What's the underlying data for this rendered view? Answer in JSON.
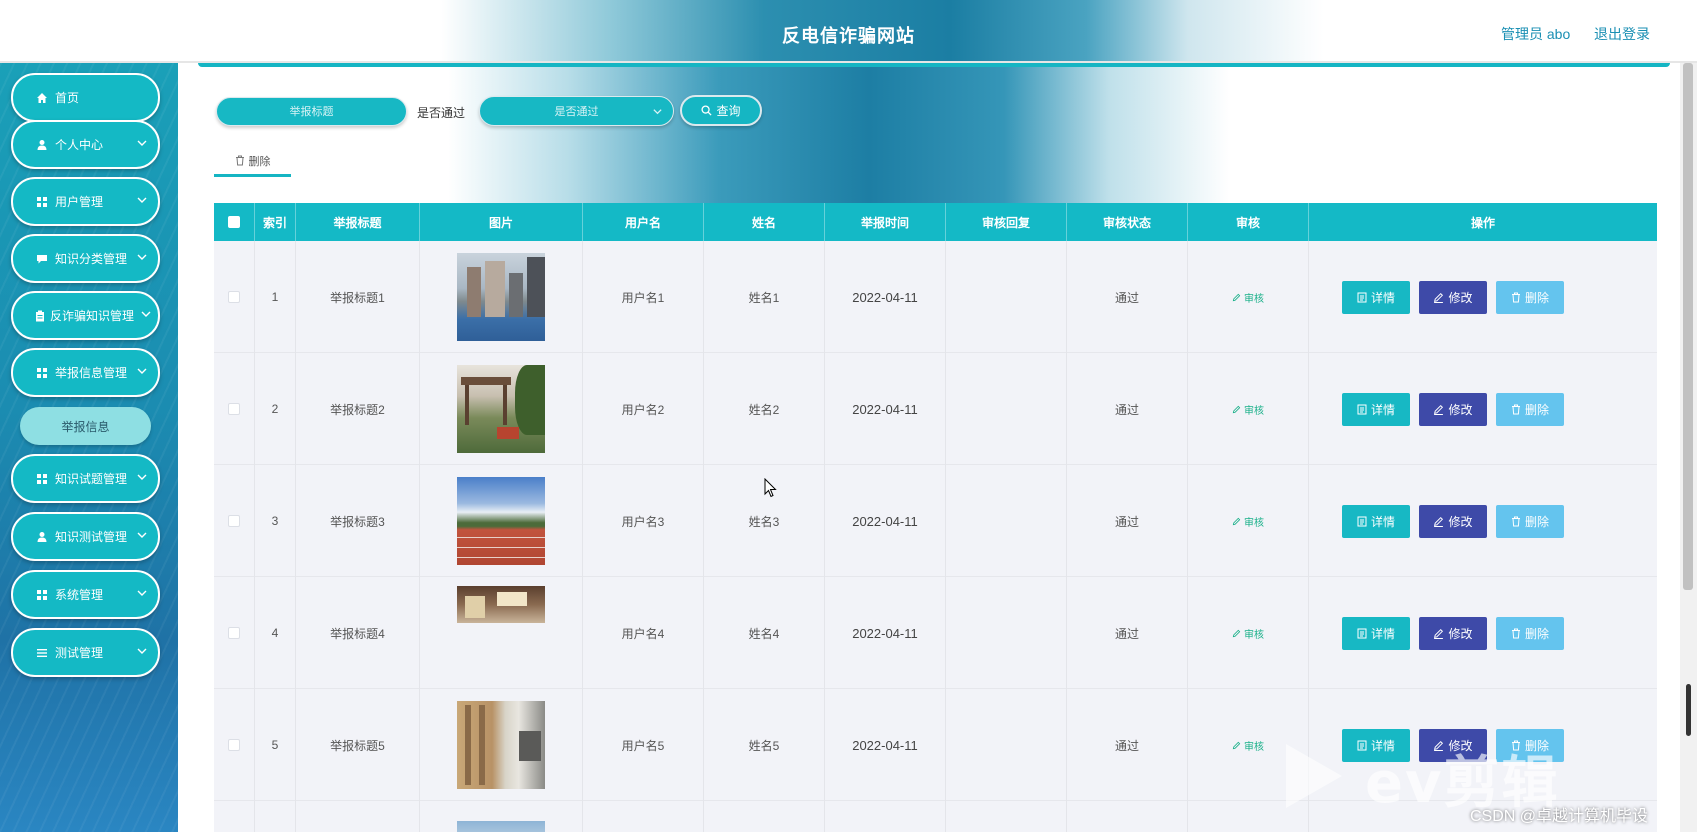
{
  "header": {
    "site_title": "反电信诈骗网站",
    "admin_label": "管理员 abo",
    "logout_label": "退出登录"
  },
  "sidebar": {
    "items": [
      {
        "label": "首页",
        "icon": "home-icon",
        "expandable": false
      },
      {
        "label": "个人中心",
        "icon": "user-icon",
        "expandable": true
      },
      {
        "label": "用户管理",
        "icon": "grid-icon",
        "expandable": true
      },
      {
        "label": "知识分类管理",
        "icon": "message-icon",
        "expandable": true
      },
      {
        "label": "反诈骗知识管理",
        "icon": "clipboard-icon",
        "expandable": true
      },
      {
        "label": "举报信息管理",
        "icon": "grid-icon",
        "expandable": true
      },
      {
        "label": "知识试题管理",
        "icon": "grid-icon",
        "expandable": true
      },
      {
        "label": "知识测试管理",
        "icon": "user-icon",
        "expandable": true
      },
      {
        "label": "系统管理",
        "icon": "grid-icon",
        "expandable": true
      },
      {
        "label": "测试管理",
        "icon": "list-icon",
        "expandable": true
      }
    ],
    "submenu_label": "举报信息"
  },
  "filters": {
    "title_placeholder": "举报标题",
    "pass_label": "是否通过",
    "pass_placeholder": "是否通过",
    "query_label": "查询",
    "delete_label": "删除"
  },
  "table": {
    "headers": [
      "索引",
      "举报标题",
      "图片",
      "用户名",
      "姓名",
      "举报时间",
      "审核回复",
      "审核状态",
      "审核",
      "操作"
    ],
    "rows": [
      {
        "index": "1",
        "title": "举报标题1",
        "username": "用户名1",
        "name": "姓名1",
        "time": "2022-04-11",
        "reply": "",
        "status": "通过",
        "image": "campus-buildings"
      },
      {
        "index": "2",
        "title": "举报标题2",
        "username": "用户名2",
        "name": "姓名2",
        "time": "2022-04-11",
        "reply": "",
        "status": "通过",
        "image": "pavilion-garden"
      },
      {
        "index": "3",
        "title": "举报标题3",
        "username": "用户名3",
        "name": "姓名3",
        "time": "2022-04-11",
        "reply": "",
        "status": "通过",
        "image": "running-track"
      },
      {
        "index": "4",
        "title": "举报标题4",
        "username": "用户名4",
        "name": "姓名4",
        "time": "2022-04-11",
        "reply": "",
        "status": "通过",
        "image": "dorm-room"
      },
      {
        "index": "5",
        "title": "举报标题5",
        "username": "用户名5",
        "name": "姓名5",
        "time": "2022-04-11",
        "reply": "",
        "status": "通过",
        "image": "corridor"
      }
    ],
    "audit_label": "审核",
    "detail_label": "详情",
    "edit_label": "修改",
    "delete_label": "删除"
  },
  "watermark": {
    "brand": "ev剪辑",
    "csdn": "CSDN @卓越计算机毕设"
  },
  "colors": {
    "accent": "#17b8c4",
    "edit_button": "#3e4aa8",
    "delete_button": "#64c4ee",
    "audit_link": "#1ab089"
  }
}
